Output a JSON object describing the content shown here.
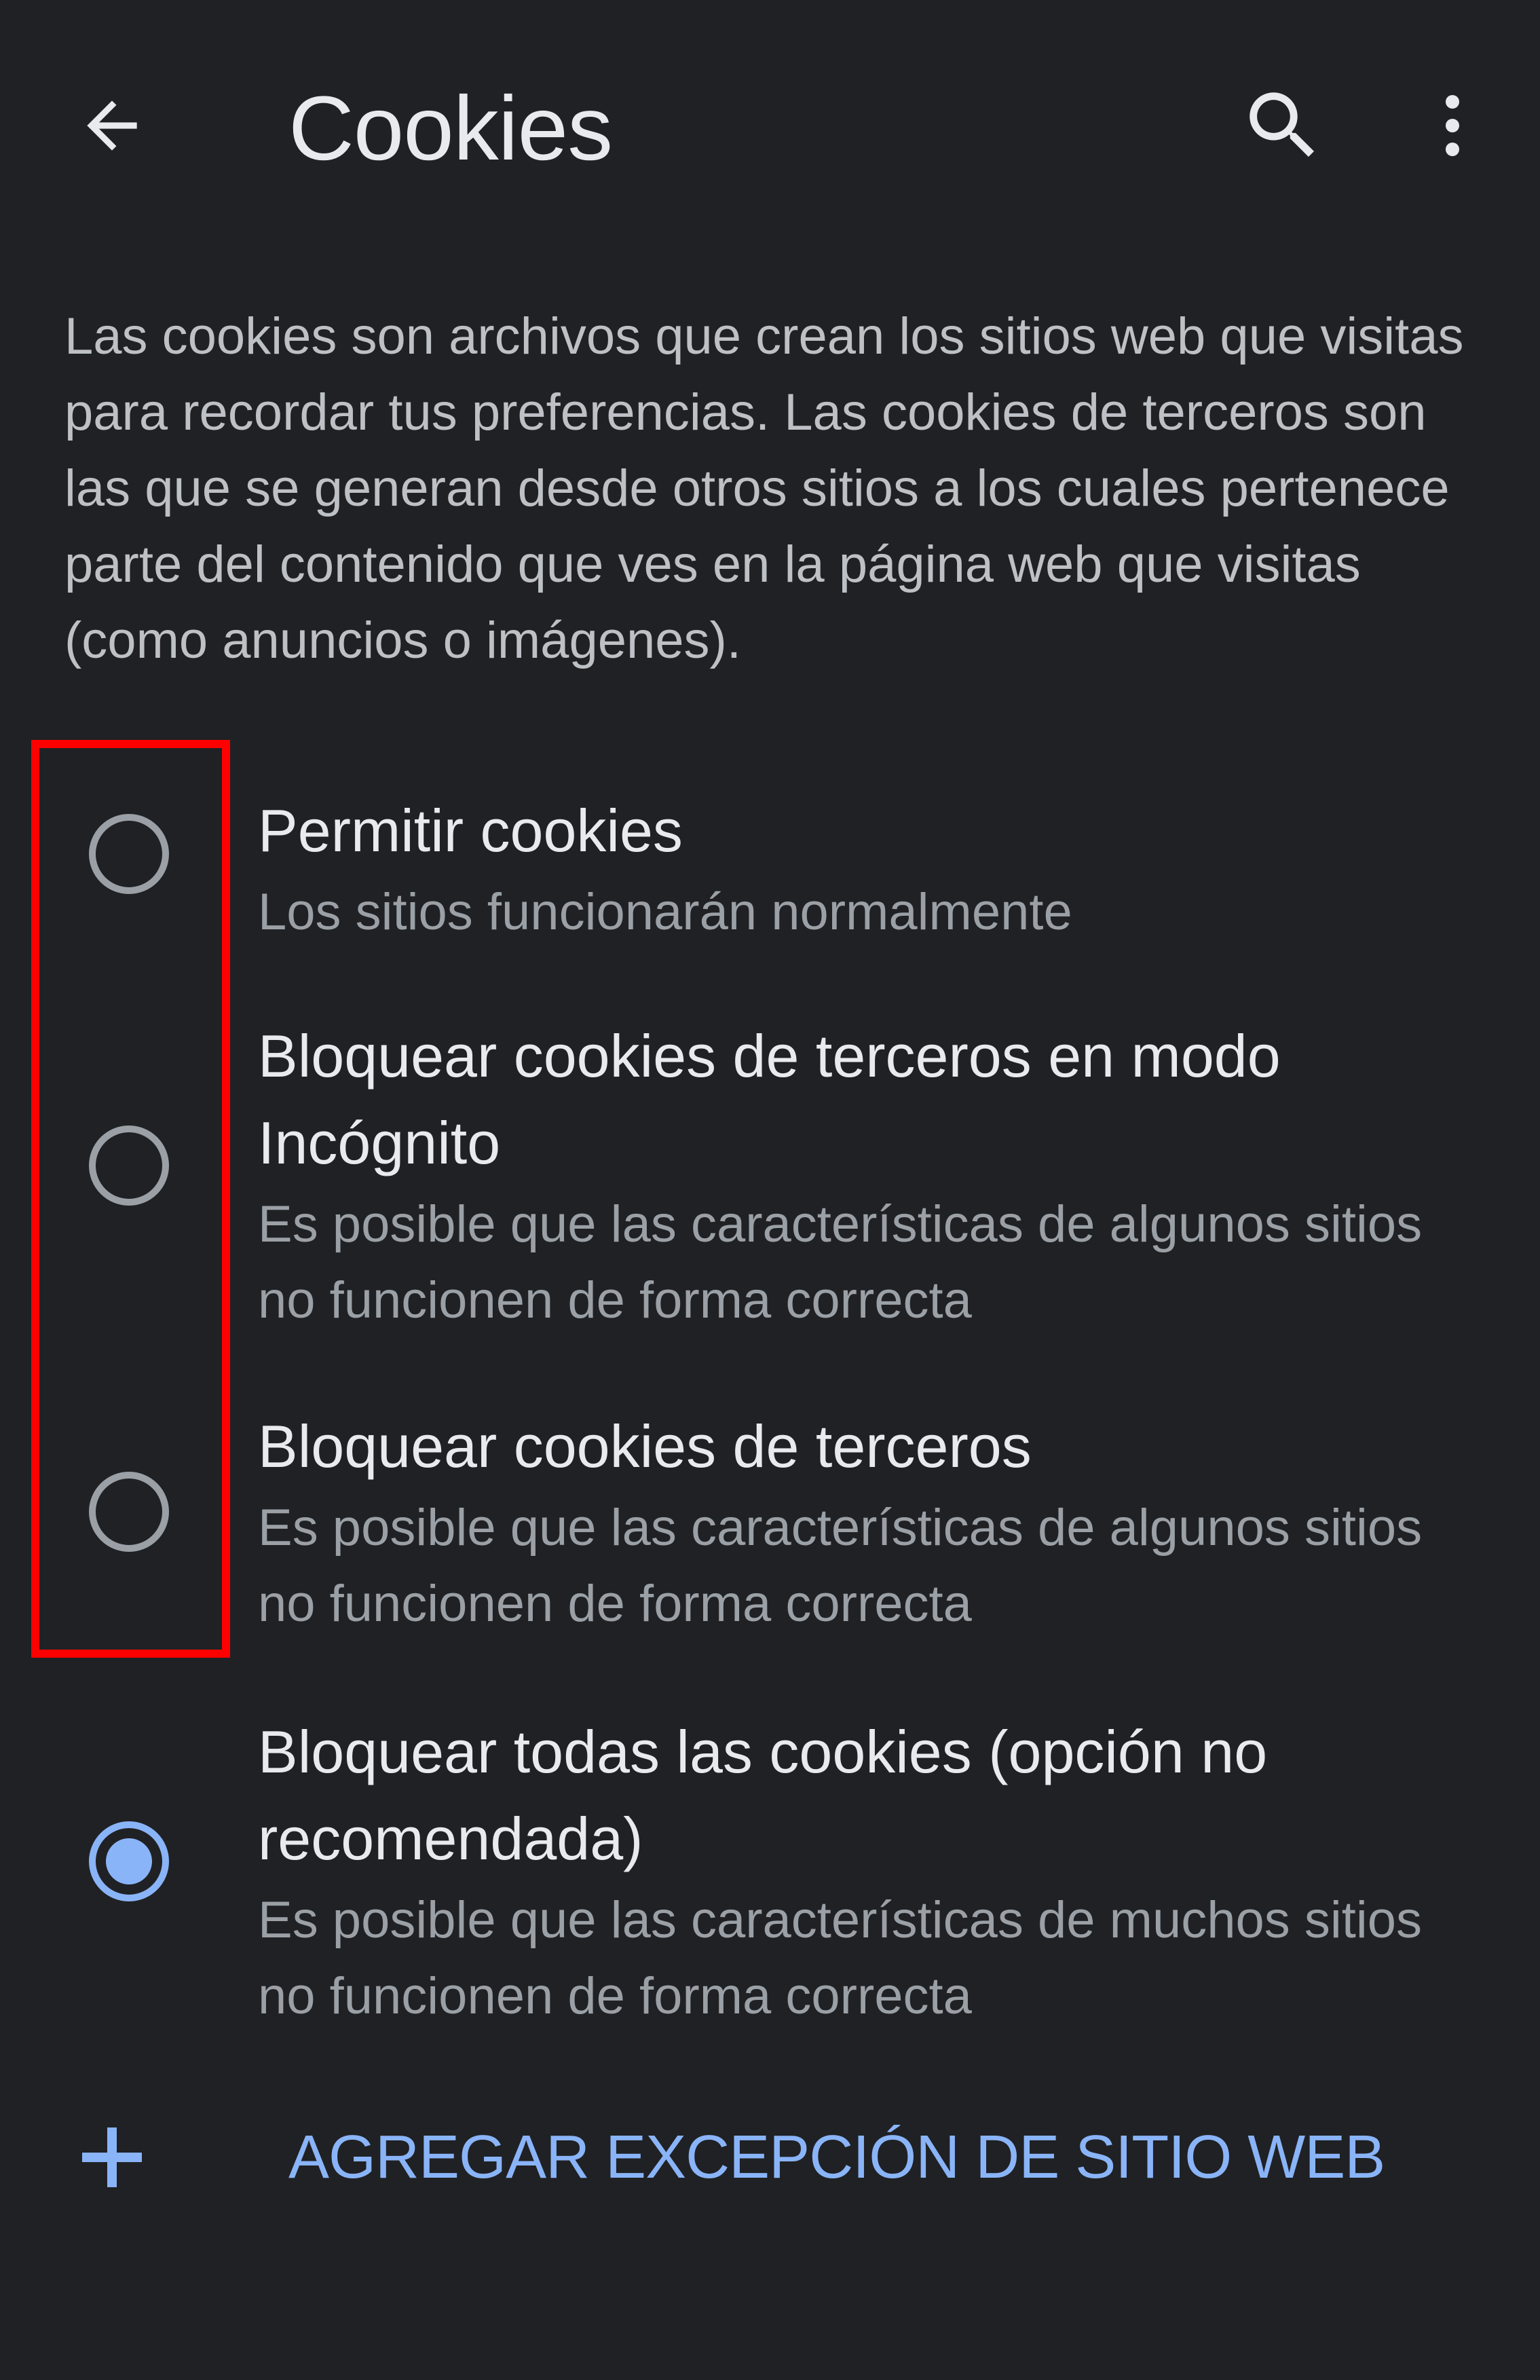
{
  "header": {
    "title": "Cookies",
    "back_icon": "arrow-left-icon",
    "search_icon": "search-icon",
    "more_icon": "more-vertical-icon"
  },
  "description": "Las cookies son archivos que crean los sitios web que visitas para recordar tus preferencias. Las cookies de terceros son las que se generan desde otros sitios a los cuales pertenece parte del contenido que ves en la página web que visitas (como anuncios o imágenes).",
  "options": [
    {
      "title": "Permitir cookies",
      "subtitle": "Los sitios funcionarán normalmente",
      "selected": false
    },
    {
      "title": "Bloquear cookies de terceros en modo Incógnito",
      "subtitle": "Es posible que las características de algunos sitios no funcionen de forma correcta",
      "selected": false
    },
    {
      "title": "Bloquear cookies de terceros",
      "subtitle": "Es posible que las características de algunos sitios no funcionen de forma correcta",
      "selected": false
    },
    {
      "title": "Bloquear todas las cookies (opción no recomendada)",
      "subtitle": "Es posible que las características de muchos sitios no funcionen de forma correcta",
      "selected": true
    }
  ],
  "add_exception": {
    "label": "AGREGAR EXCEPCIÓN DE SITIO WEB",
    "icon": "plus-icon"
  },
  "colors": {
    "background": "#202124",
    "text_primary": "#e8eaed",
    "text_secondary": "#9aa0a6",
    "accent": "#8ab4f8",
    "radio_unselected": "#9aa0a6",
    "highlight": "#ff0000"
  }
}
